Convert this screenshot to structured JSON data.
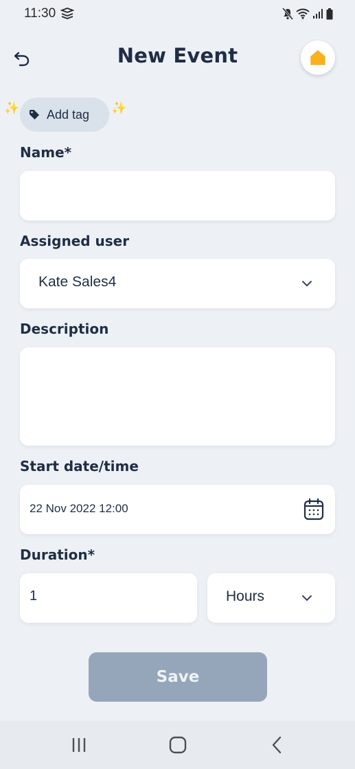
{
  "status_bar": {
    "time": "11:30",
    "icons": [
      "layers-icon",
      "mute-icon",
      "wifi-icon",
      "signal-icon",
      "battery-icon"
    ]
  },
  "header": {
    "title": "New Event",
    "back_icon": "undo-arrow-icon",
    "home_icon": "home-icon"
  },
  "tag": {
    "label": "Add tag",
    "icon": "tag-icon"
  },
  "form": {
    "name": {
      "label": "Name*",
      "value": ""
    },
    "assigned_user": {
      "label": "Assigned user",
      "value": "Kate Sales4"
    },
    "description": {
      "label": "Description",
      "value": ""
    },
    "start": {
      "label": "Start date/time",
      "value": "22 Nov 2022 12:00",
      "icon": "calendar-icon"
    },
    "duration": {
      "label": "Duration*",
      "value": "1",
      "unit": "Hours"
    }
  },
  "actions": {
    "save_label": "Save"
  },
  "colors": {
    "background": "#edf1f5",
    "text_primary": "#1f2d45",
    "home_accent": "#f9b21d",
    "save_disabled": "#96a6ba",
    "tag_chip": "#d9e1ea"
  }
}
